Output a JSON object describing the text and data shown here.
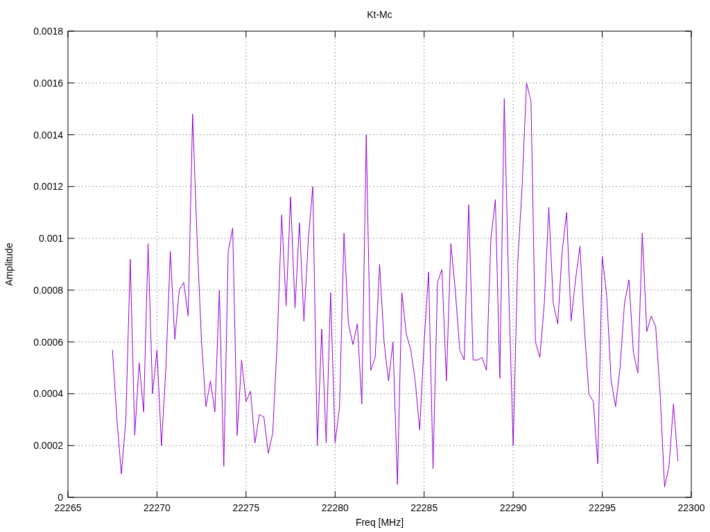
{
  "chart_data": {
    "type": "line",
    "title": "Kt-Mc",
    "xlabel": "Freq [MHz]",
    "ylabel": "Amplitude",
    "x": [
      22267.5,
      22267.75,
      22268,
      22268.25,
      22268.5,
      22268.75,
      22269,
      22269.25,
      22269.5,
      22269.75,
      22270,
      22270.25,
      22270.5,
      22270.75,
      22271,
      22271.25,
      22271.5,
      22271.75,
      22272,
      22272.25,
      22272.5,
      22272.75,
      22273,
      22273.25,
      22273.5,
      22273.75,
      22274,
      22274.25,
      22274.5,
      22274.75,
      22275,
      22275.25,
      22275.5,
      22275.75,
      22276,
      22276.25,
      22276.5,
      22276.75,
      22277,
      22277.25,
      22277.5,
      22277.75,
      22278,
      22278.25,
      22278.5,
      22278.75,
      22279,
      22279.25,
      22279.5,
      22279.75,
      22280,
      22280.25,
      22280.5,
      22280.75,
      22281,
      22281.25,
      22281.5,
      22281.75,
      22282,
      22282.25,
      22282.5,
      22282.75,
      22283,
      22283.25,
      22283.5,
      22283.75,
      22284,
      22284.25,
      22284.5,
      22284.75,
      22285,
      22285.25,
      22285.5,
      22285.75,
      22286,
      22286.25,
      22286.5,
      22286.75,
      22287,
      22287.25,
      22287.5,
      22287.75,
      22288,
      22288.25,
      22288.5,
      22288.75,
      22289,
      22289.25,
      22289.5,
      22289.75,
      22290,
      22290.25,
      22290.5,
      22290.75,
      22291,
      22291.25,
      22291.5,
      22291.75,
      22292,
      22292.25,
      22292.5,
      22292.75,
      22293,
      22293.25,
      22293.5,
      22293.75,
      22294,
      22294.25,
      22294.5,
      22294.75,
      22295,
      22295.25,
      22295.5,
      22295.75,
      22296,
      22296.25,
      22296.5,
      22296.75,
      22297,
      22297.25,
      22297.5,
      22297.75,
      22298,
      22298.25,
      22298.5,
      22298.75,
      22299,
      22299.25
    ],
    "series": [
      {
        "color": "#9400d3",
        "values": [
          0.00057,
          0.0003,
          9e-05,
          0.0003,
          0.00092,
          0.00024,
          0.00052,
          0.00033,
          0.00098,
          0.0004,
          0.00057,
          0.0002,
          0.0005,
          0.00095,
          0.00061,
          0.0008,
          0.00083,
          0.0007,
          0.00148,
          0.001,
          0.0006,
          0.00035,
          0.00045,
          0.00033,
          0.0008,
          0.00012,
          0.00095,
          0.00104,
          0.00024,
          0.00053,
          0.00037,
          0.00041,
          0.00021,
          0.00032,
          0.00031,
          0.00017,
          0.00025,
          0.0006,
          0.00109,
          0.00074,
          0.00116,
          0.00073,
          0.00106,
          0.00068,
          0.001,
          0.0012,
          0.0002,
          0.00065,
          0.00021,
          0.00079,
          0.00021,
          0.00035,
          0.00102,
          0.00067,
          0.00059,
          0.00067,
          0.00036,
          0.0014,
          0.00049,
          0.00054,
          0.0009,
          0.0006,
          0.00045,
          0.0006,
          5e-05,
          0.00079,
          0.00063,
          0.00057,
          0.00045,
          0.00026,
          0.0006,
          0.00087,
          0.00011,
          0.00083,
          0.00088,
          0.00045,
          0.00098,
          0.0008,
          0.00057,
          0.00053,
          0.00113,
          0.00053,
          0.00053,
          0.00054,
          0.00049,
          0.001,
          0.00115,
          0.00046,
          0.00154,
          0.0008,
          0.0002,
          0.0009,
          0.0012,
          0.0016,
          0.00153,
          0.0006,
          0.00054,
          0.00075,
          0.00112,
          0.00075,
          0.00067,
          0.00095,
          0.0011,
          0.00068,
          0.00084,
          0.00097,
          0.00065,
          0.0004,
          0.00037,
          0.00013,
          0.00093,
          0.00078,
          0.00045,
          0.00035,
          0.0005,
          0.00075,
          0.00084,
          0.00056,
          0.00048,
          0.00102,
          0.00064,
          0.0007,
          0.00066,
          0.0004,
          4e-05,
          0.00012,
          0.00036,
          0.00014
        ]
      }
    ],
    "grid": true,
    "xlim": [
      22265,
      22300
    ],
    "ylim": [
      0,
      0.0018
    ],
    "xticks": [
      22265,
      22270,
      22275,
      22280,
      22285,
      22290,
      22295,
      22300
    ],
    "yticks": [
      0,
      0.0002,
      0.0004,
      0.0006,
      0.0008,
      0.001,
      0.0012,
      0.0014,
      0.0016,
      0.0018
    ]
  }
}
